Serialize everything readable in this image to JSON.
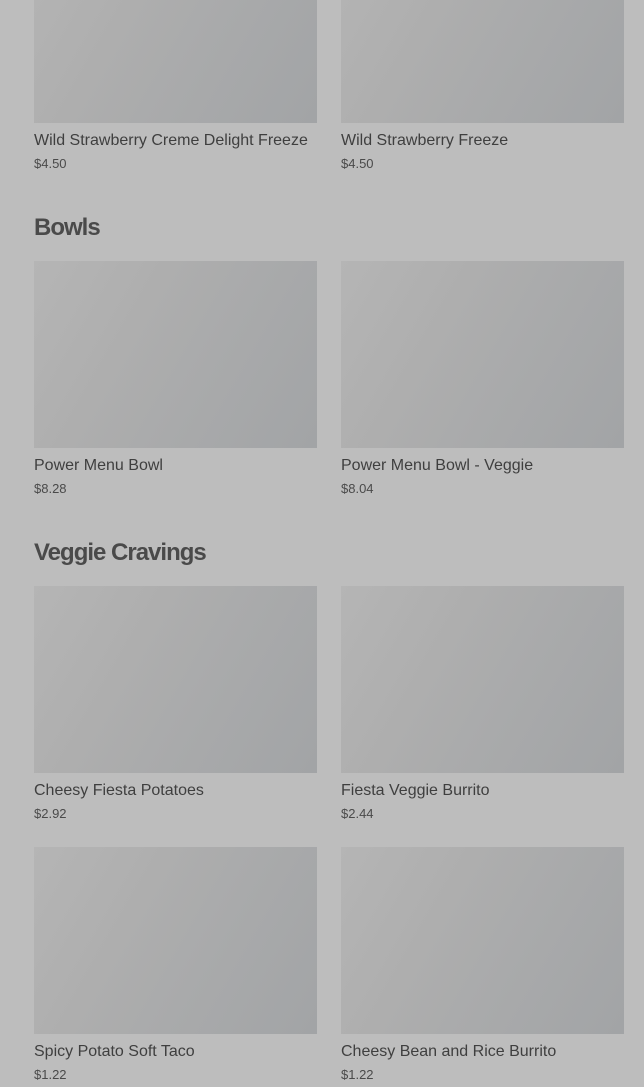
{
  "menu": {
    "freezes": {
      "items": [
        {
          "name": "Wild Strawberry Creme Delight Freeze",
          "price": "$4.50"
        },
        {
          "name": "Wild Strawberry Freeze",
          "price": "$4.50"
        }
      ]
    },
    "bowls": {
      "title": "Bowls",
      "items": [
        {
          "name": "Power Menu Bowl",
          "price": "$8.28"
        },
        {
          "name": "Power Menu Bowl - Veggie",
          "price": "$8.04"
        }
      ]
    },
    "veggie": {
      "title": "Veggie Cravings",
      "items": [
        {
          "name": "Cheesy Fiesta Potatoes",
          "price": "$2.92"
        },
        {
          "name": "Fiesta Veggie Burrito",
          "price": "$2.44"
        },
        {
          "name": "Spicy Potato Soft Taco",
          "price": "$1.22"
        },
        {
          "name": "Cheesy Bean and Rice Burrito",
          "price": "$1.22"
        }
      ]
    }
  },
  "colors": {
    "background": "#bdbdbd",
    "image_placeholder": "#adaeaf",
    "text_primary": "#3f3f3f",
    "heading": "#4a4a4a"
  }
}
